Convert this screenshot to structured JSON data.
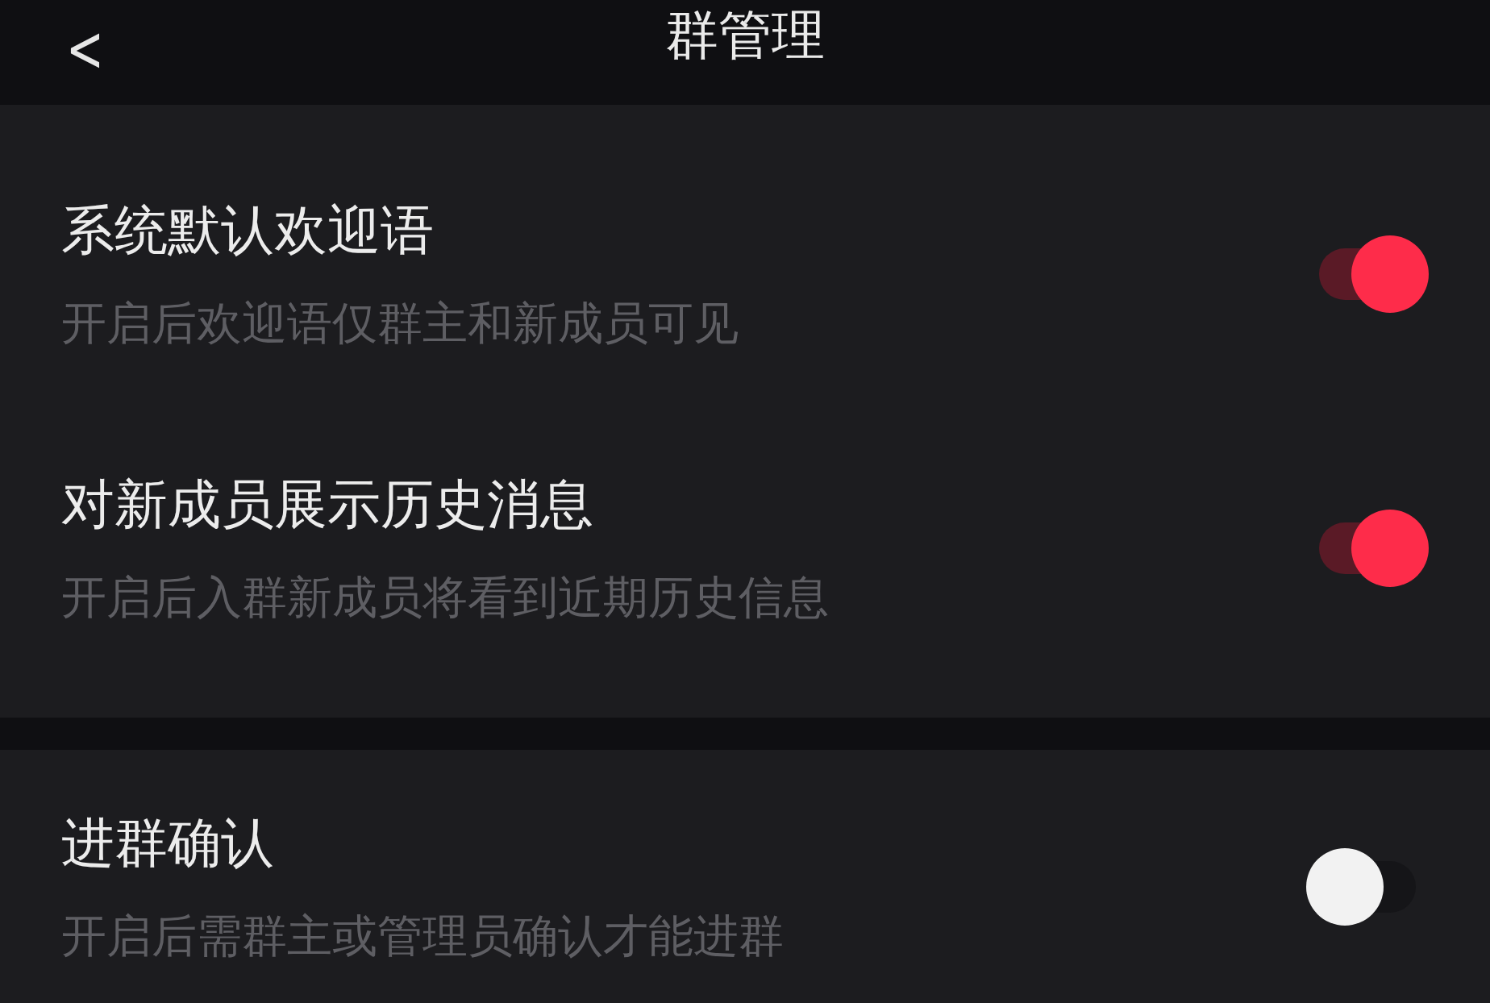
{
  "header": {
    "back": "<",
    "title": "群管理"
  },
  "sections": [
    {
      "items": [
        {
          "title": "系统默认欢迎语",
          "description": "开启后欢迎语仅群主和新成员可见",
          "on": true
        },
        {
          "title": "对新成员展示历史消息",
          "description": "开启后入群新成员将看到近期历史信息",
          "on": true
        }
      ]
    },
    {
      "items": [
        {
          "title": "进群确认",
          "description": "开启后需群主或管理员确认才能进群",
          "on": false
        }
      ]
    }
  ]
}
